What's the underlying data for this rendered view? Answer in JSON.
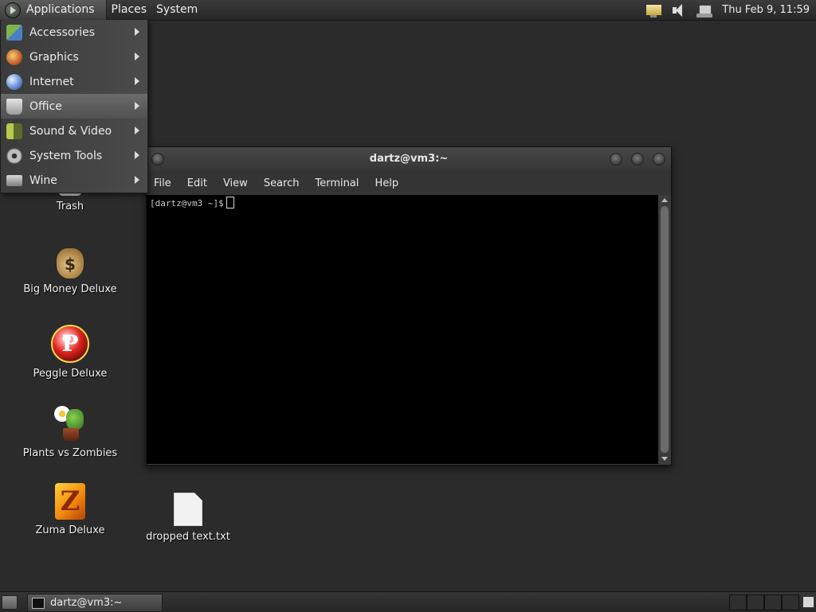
{
  "top_panel": {
    "menus": [
      "Applications",
      "Places",
      "System"
    ],
    "clock": "Thu Feb  9, 11:59"
  },
  "app_menu": {
    "items": [
      {
        "label": "Accessories"
      },
      {
        "label": "Graphics"
      },
      {
        "label": "Internet"
      },
      {
        "label": "Office"
      },
      {
        "label": "Sound & Video"
      },
      {
        "label": "System Tools"
      },
      {
        "label": "Wine"
      }
    ],
    "highlighted": "Office"
  },
  "desktop_icons": {
    "trash": "Trash",
    "big_money": "Big Money Deluxe",
    "peggle": "Peggle Deluxe",
    "plants": "Plants vs Zombies",
    "zuma": "Zuma Deluxe",
    "dropped_file": "dropped text.txt"
  },
  "terminal": {
    "title": "dartz@vm3:~",
    "menu": [
      "File",
      "Edit",
      "View",
      "Search",
      "Terminal",
      "Help"
    ],
    "prompt": "[dartz@vm3 ~]$"
  },
  "taskbar": {
    "window_button": "dartz@vm3:~"
  }
}
